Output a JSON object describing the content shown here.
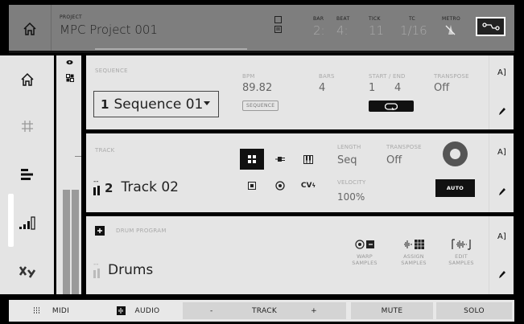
{
  "topbar": {
    "project_label": "PROJECT",
    "project_name": "MPC Project 001",
    "bar_label": "BAR",
    "bar_value": "2:",
    "beat_label": "BEAT",
    "beat_value": "4:",
    "tick_label": "TICK",
    "tick_value": "11",
    "tc_label": "TC",
    "tc_value": "1/16",
    "metro_label": "METRO"
  },
  "sequence": {
    "label": "SEQUENCE",
    "number": "1",
    "name": "Sequence 01",
    "bpm_label": "BPM",
    "bpm_value": "89.82",
    "bpm_button": "SEQUENCE",
    "bars_label": "BARS",
    "bars_value": "4",
    "start_end_label": "START / END",
    "start_value": "1",
    "end_value": "4",
    "transpose_label": "TRANSPOSE",
    "transpose_value": "Off"
  },
  "track": {
    "label": "TRACK",
    "dash": "--",
    "number": "2",
    "name": "Track 02",
    "cv_label": "CV",
    "length_label": "LENGTH",
    "length_value": "Seq",
    "transpose_label": "TRANSPOSE",
    "transpose_value": "Off",
    "velocity_label": "VELOCITY",
    "velocity_value": "100%",
    "auto_label": "AUTO"
  },
  "drum": {
    "label": "DRUM PROGRAM",
    "dash": "--",
    "name": "Drums",
    "tools": [
      {
        "line1": "WARP",
        "line2": "SAMPLES"
      },
      {
        "line1": "ASSIGN",
        "line2": "SAMPLES"
      },
      {
        "line1": "EDIT",
        "line2": "SAMPLES"
      }
    ]
  },
  "bottombar": {
    "midi": "MIDI",
    "audio": "AUDIO",
    "minus": "-",
    "track": "TRACK",
    "plus": "+",
    "mute": "MUTE",
    "solo": "SOLO"
  },
  "meters": {
    "left_level": 0.45,
    "right_level": 0.45
  },
  "colors": {
    "background": "#000000",
    "topbar": "#7e7e7e",
    "panel": "#e5e5e5",
    "accent": "#111111"
  }
}
